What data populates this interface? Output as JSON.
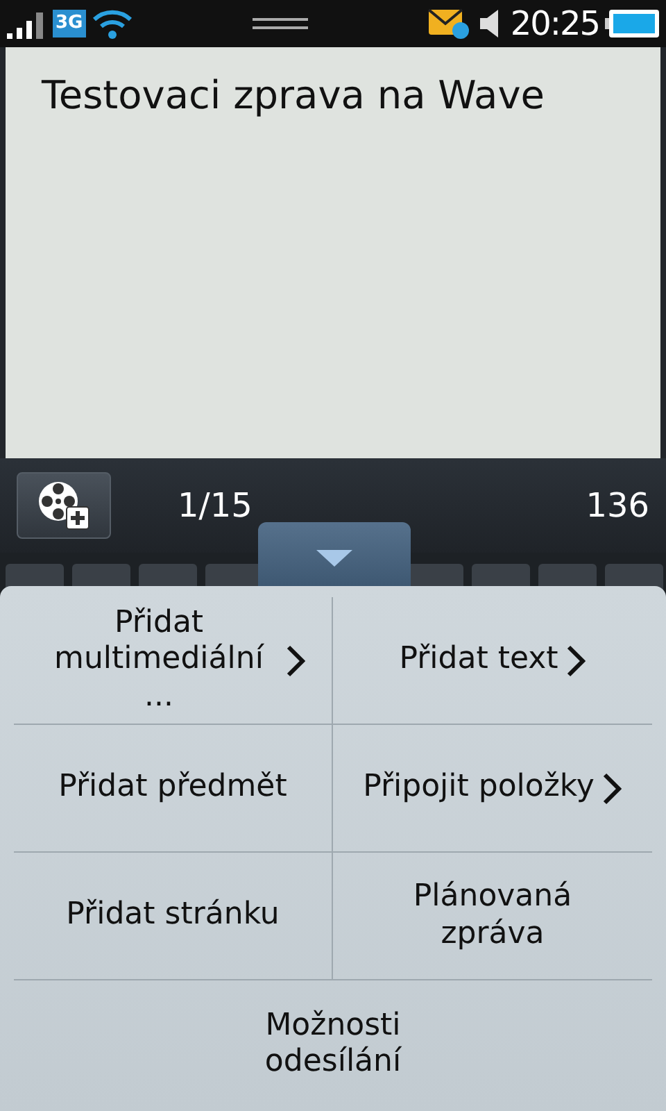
{
  "status_bar": {
    "network": "3G",
    "time": "20:25"
  },
  "message": {
    "text": "Testovaci zprava na Wave"
  },
  "toolbar": {
    "page": "1/15",
    "chars_left": "136"
  },
  "menu": {
    "items": [
      {
        "label": "Přidat multimediální ...",
        "submenu": true
      },
      {
        "label": "Přidat text",
        "submenu": true
      },
      {
        "label": "Přidat předmět",
        "submenu": false
      },
      {
        "label": "Připojit položky",
        "submenu": true
      },
      {
        "label": "Přidat stránku",
        "submenu": false
      },
      {
        "label": "Plánovaná zpráva",
        "submenu": false
      },
      {
        "label": "Možnosti odesílání",
        "submenu": false
      }
    ]
  }
}
